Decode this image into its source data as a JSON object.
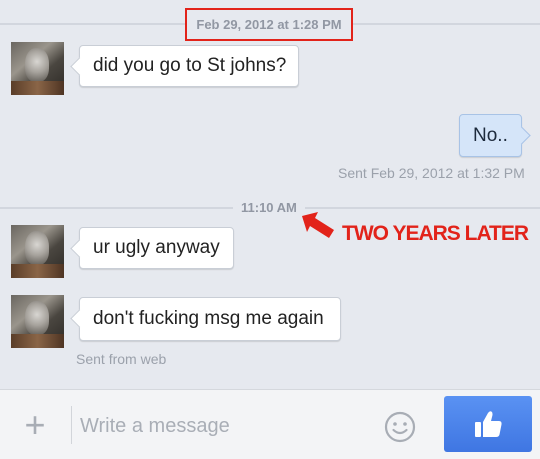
{
  "thread": {
    "first_separator": {
      "label": "Feb 29, 2012 at 1:28 PM"
    },
    "second_separator": {
      "label": "11:10 AM"
    }
  },
  "messages": [
    {
      "text": "did you go to St johns?",
      "sender": "them"
    },
    {
      "text": "No..",
      "sender": "me",
      "status": "Sent Feb 29, 2012 at 1:32 PM"
    },
    {
      "text": "ur ugly anyway",
      "sender": "them"
    },
    {
      "text": "don't fucking msg me again",
      "sender": "them",
      "status": "Sent from web"
    }
  ],
  "annotation": {
    "text": "TWO YEARS LATER",
    "color": "#e2231a"
  },
  "composer": {
    "add_icon": "+",
    "placeholder": "Write a message",
    "emoji_icon": "smiley-icon",
    "like_icon": "thumbs-up-icon"
  },
  "colors": {
    "background": "#e6e9ef",
    "my_bubble": "#d5e5f9",
    "like_button": "#4a84ec",
    "highlight": "#e2231a"
  }
}
